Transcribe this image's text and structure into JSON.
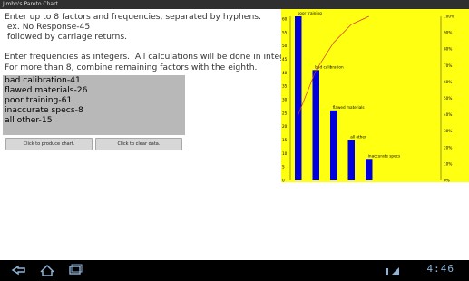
{
  "window": {
    "title": "Jimbo's Pareto Chart"
  },
  "instructions": [
    "Enter up to 8 factors and frequencies, separated by hyphens.",
    " ex. No Response-45",
    " followed by carriage returns.",
    "",
    "Enter frequencies as integers.  All calculations will be done in integers.",
    "For more than 8, combine remaining factors with the eighth."
  ],
  "entry": {
    "lines": [
      "bad calibration-41",
      "flawed materials-26",
      "poor training-61",
      "inaccurate specs-8",
      "all other-15"
    ]
  },
  "buttons": {
    "produce_label": "Click to produce chart.",
    "clear_label": "Click to clear data."
  },
  "chart_data": {
    "type": "bar",
    "categories": [
      "poor training",
      "bad calibration",
      "flawed materials",
      "all other",
      "inaccurate specs"
    ],
    "values": [
      61,
      41,
      26,
      15,
      8
    ],
    "cumulative_percent": [
      40,
      67,
      84,
      95,
      100
    ],
    "left_ticks": [
      "60",
      "55",
      "50",
      "45",
      "40",
      "35",
      "30",
      "25",
      "20",
      "15",
      "10",
      "5",
      "0"
    ],
    "right_ticks": [
      "100%",
      "90%",
      "80%",
      "70%",
      "60%",
      "50%",
      "40%",
      "30%",
      "20%",
      "10%",
      "0%"
    ],
    "ylim": [
      0,
      61
    ],
    "y2lim": [
      0,
      100
    ],
    "bar_color": "#0000dd",
    "line_color": "#cc3333",
    "background": "#ffff11"
  },
  "system": {
    "clock": "4:46",
    "icons": [
      "back-icon",
      "home-icon",
      "recent-apps-icon"
    ]
  }
}
